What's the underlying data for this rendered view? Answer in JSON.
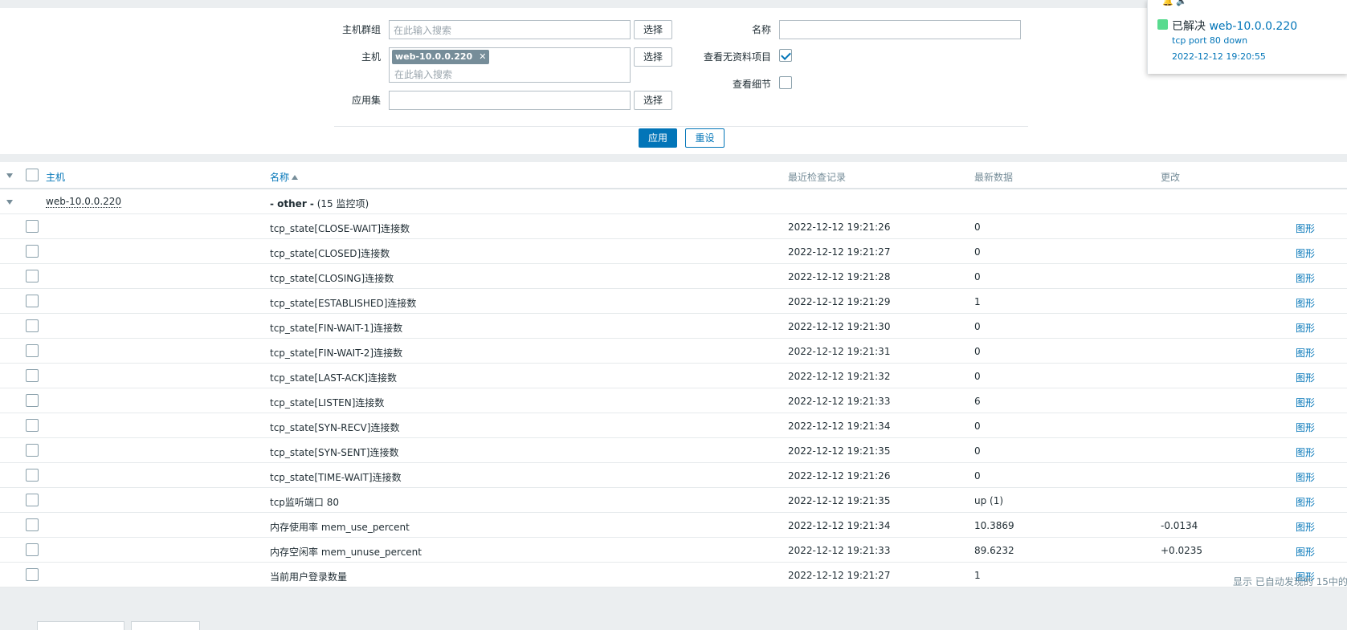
{
  "filter": {
    "host_group_label": "主机群组",
    "host_group_placeholder": "在此输入搜索",
    "select_label": "选择",
    "host_label": "主机",
    "host_chip": "web-10.0.0.220",
    "host_placeholder": "在此输入搜索",
    "app_label": "应用集",
    "name_label": "名称",
    "name_value": "",
    "show_no_data_label": "查看无资料项目",
    "show_no_data_checked": true,
    "show_details_label": "查看细节",
    "show_details_checked": false,
    "apply_label": "应用",
    "reset_label": "重设"
  },
  "notification": {
    "status": "已解决",
    "host": "web-10.0.0.220",
    "message": "tcp port 80 down",
    "time": "2022-12-12 19:20:55",
    "status_color": "#59db8f"
  },
  "table": {
    "columns": {
      "host": "主机",
      "name": "名称",
      "last_check": "最近检查记录",
      "last_value": "最新数据",
      "change": "更改"
    },
    "group": {
      "host": "web-10.0.0.220",
      "name_bold": "- other -",
      "name_count": "(15 监控项)"
    },
    "rows": [
      {
        "name": "tcp_state[CLOSE-WAIT]连接数",
        "last_check": "2022-12-12 19:21:26",
        "last_value": "0",
        "change": "",
        "graph": "图形"
      },
      {
        "name": "tcp_state[CLOSED]连接数",
        "last_check": "2022-12-12 19:21:27",
        "last_value": "0",
        "change": "",
        "graph": "图形"
      },
      {
        "name": "tcp_state[CLOSING]连接数",
        "last_check": "2022-12-12 19:21:28",
        "last_value": "0",
        "change": "",
        "graph": "图形"
      },
      {
        "name": "tcp_state[ESTABLISHED]连接数",
        "last_check": "2022-12-12 19:21:29",
        "last_value": "1",
        "change": "",
        "graph": "图形"
      },
      {
        "name": "tcp_state[FIN-WAIT-1]连接数",
        "last_check": "2022-12-12 19:21:30",
        "last_value": "0",
        "change": "",
        "graph": "图形"
      },
      {
        "name": "tcp_state[FIN-WAIT-2]连接数",
        "last_check": "2022-12-12 19:21:31",
        "last_value": "0",
        "change": "",
        "graph": "图形"
      },
      {
        "name": "tcp_state[LAST-ACK]连接数",
        "last_check": "2022-12-12 19:21:32",
        "last_value": "0",
        "change": "",
        "graph": "图形"
      },
      {
        "name": "tcp_state[LISTEN]连接数",
        "last_check": "2022-12-12 19:21:33",
        "last_value": "6",
        "change": "",
        "graph": "图形"
      },
      {
        "name": "tcp_state[SYN-RECV]连接数",
        "last_check": "2022-12-12 19:21:34",
        "last_value": "0",
        "change": "",
        "graph": "图形"
      },
      {
        "name": "tcp_state[SYN-SENT]连接数",
        "last_check": "2022-12-12 19:21:35",
        "last_value": "0",
        "change": "",
        "graph": "图形"
      },
      {
        "name": "tcp_state[TIME-WAIT]连接数",
        "last_check": "2022-12-12 19:21:26",
        "last_value": "0",
        "change": "",
        "graph": "图形"
      },
      {
        "name": "tcp监听端口 80",
        "last_check": "2022-12-12 19:21:35",
        "last_value": "up (1)",
        "change": "",
        "graph": "图形"
      },
      {
        "name": "内存使用率 mem_use_percent",
        "last_check": "2022-12-12 19:21:34",
        "last_value": "10.3869",
        "change": "-0.0134",
        "graph": "图形"
      },
      {
        "name": "内存空闲率 mem_unuse_percent",
        "last_check": "2022-12-12 19:21:33",
        "last_value": "89.6232",
        "change": "+0.0235",
        "graph": "图形"
      },
      {
        "name": "当前用户登录数量",
        "last_check": "2022-12-12 19:21:27",
        "last_value": "1",
        "change": "",
        "graph": "图形"
      }
    ],
    "footer": "显示 已自动发现的 15中的"
  }
}
